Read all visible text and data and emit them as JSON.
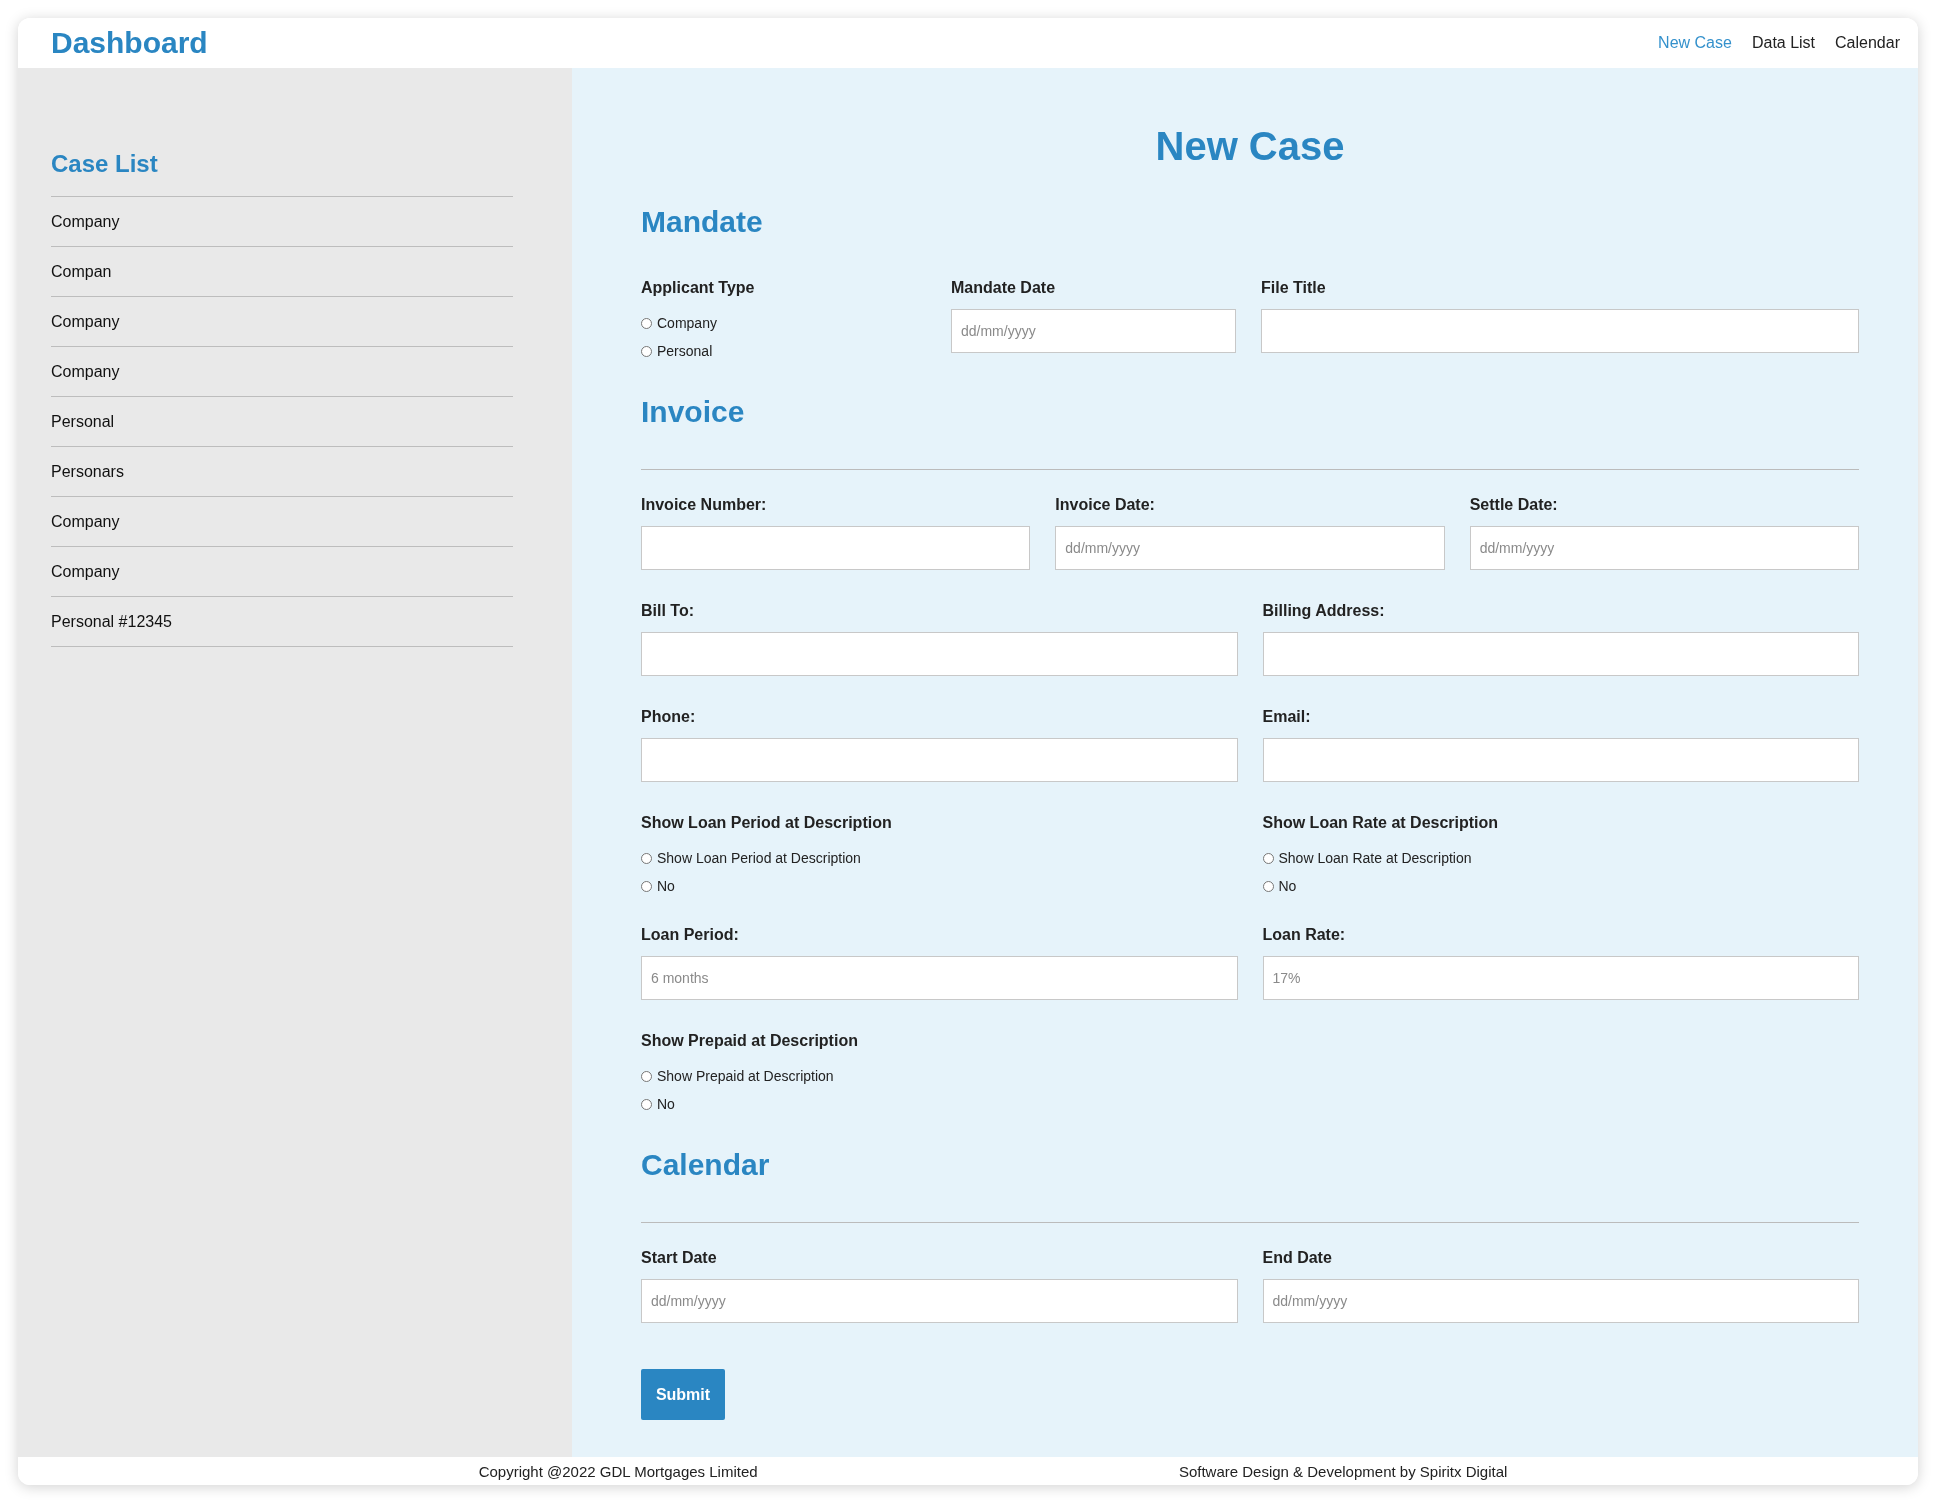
{
  "header": {
    "title": "Dashboard",
    "nav": [
      {
        "label": "New Case",
        "selected": true
      },
      {
        "label": "Data List",
        "selected": false
      },
      {
        "label": "Calendar",
        "selected": false
      }
    ]
  },
  "sidebar": {
    "title": "Case List",
    "items": [
      "Company",
      "Compan",
      "Company",
      "Company",
      "Personal",
      "Personars",
      "Company",
      "Company",
      "Personal #12345"
    ]
  },
  "form": {
    "title": "New Case",
    "sections": [
      {
        "kind": "mandate",
        "heading": "Mandate",
        "rows": [
          [
            {
              "kind": "radio",
              "label": "Applicant Type",
              "options": [
                {
                  "label": "Company",
                  "selected": false
                },
                {
                  "label": "Personal",
                  "selected": false
                }
              ]
            },
            {
              "kind": "input",
              "label": "Mandate Date",
              "placeholder": "dd/mm/yyyy"
            },
            {
              "kind": "input",
              "label": "File Title"
            }
          ]
        ]
      },
      {
        "kind": "grid",
        "heading": "Invoice",
        "rows": [
          [
            {
              "kind": "input",
              "label": "Invoice Number:"
            },
            {
              "kind": "input",
              "label": "Invoice Date:",
              "placeholder": "dd/mm/yyyy"
            },
            {
              "kind": "input",
              "label": "Settle Date:",
              "placeholder": "dd/mm/yyyy"
            }
          ],
          [
            {
              "kind": "input",
              "label": "Bill To:"
            },
            {
              "kind": "input",
              "label": "Billing Address:"
            }
          ],
          [
            {
              "kind": "input",
              "label": "Phone:"
            },
            {
              "kind": "input",
              "label": "Email:"
            }
          ],
          [
            {
              "kind": "radio",
              "label": "Show Loan Period at Description",
              "options": [
                {
                  "label": "Show Loan Period at Description",
                  "selected": false
                },
                {
                  "label": "No",
                  "selected": false
                }
              ]
            },
            {
              "kind": "radio",
              "label": "Show Loan Rate at Description",
              "options": [
                {
                  "label": "Show Loan Rate at Description",
                  "selected": false
                },
                {
                  "label": "No",
                  "selected": false
                }
              ]
            }
          ],
          [
            {
              "kind": "input",
              "label": "Loan Period:",
              "placeholder": "6 months"
            },
            {
              "kind": "input",
              "label": "Loan Rate:",
              "placeholder": "17%"
            }
          ],
          [
            {
              "kind": "radio",
              "label": "Show Prepaid at Description",
              "options": [
                {
                  "label": "Show Prepaid at Description",
                  "selected": false
                },
                {
                  "label": "No",
                  "selected": false
                }
              ]
            }
          ]
        ]
      },
      {
        "kind": "grid",
        "heading": "Calendar",
        "rows": [
          [
            {
              "kind": "input",
              "label": "Start Date",
              "placeholder": "dd/mm/yyyy"
            },
            {
              "kind": "input",
              "label": "End Date",
              "placeholder": "dd/mm/yyyy"
            }
          ]
        ]
      }
    ],
    "submit": "Submit"
  },
  "footer": {
    "left": "Copyright @2022 GDL Mortgages Limited",
    "right": "Software Design & Development by Spiritx Digital"
  }
}
